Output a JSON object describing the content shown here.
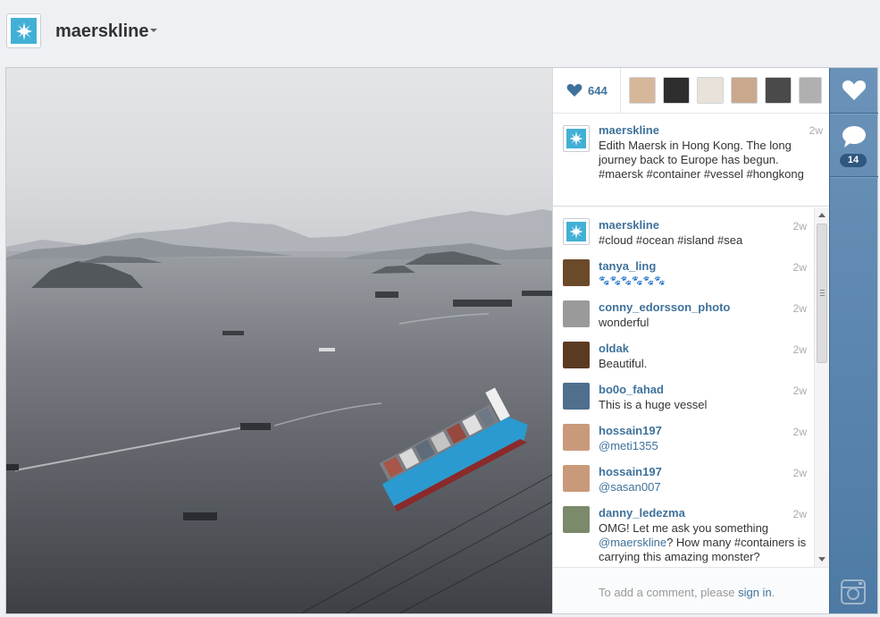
{
  "header": {
    "username": "maerskline"
  },
  "likes": {
    "count": "644"
  },
  "caption": {
    "user": "maerskline",
    "time": "2w",
    "text": "Edith Maersk in Hong Kong. The long journey back to Europe has begun. #maersk #container #vessel #hongkong"
  },
  "comments": [
    {
      "user": "maerskline",
      "time": "2w",
      "text": "#cloud #ocean #island #sea"
    },
    {
      "user": "tanya_ling",
      "time": "2w",
      "text": "🐾🐾🐾🐾🐾🐾"
    },
    {
      "user": "conny_edorsson_photo",
      "time": "2w",
      "text": "wonderful"
    },
    {
      "user": "oldak",
      "time": "2w",
      "text": "Beautiful."
    },
    {
      "user": "bo0o_fahad",
      "time": "2w",
      "text": "This is a huge vessel"
    },
    {
      "user": "hossain197",
      "time": "2w",
      "text": "@meti1355"
    },
    {
      "user": "hossain197",
      "time": "2w",
      "text": "@sasan007"
    },
    {
      "user": "danny_ledezma",
      "time": "2w",
      "text_pre": "OMG! Let me ask you something ",
      "mention": "@maerskline",
      "text_post": "? How many #containers is carrying this amazing monster?"
    }
  ],
  "add_comment": {
    "prompt": "To add a comment, please ",
    "link": "sign in",
    "suffix": "."
  },
  "actionbar": {
    "comment_count": "14"
  },
  "icons": {
    "logo": "maersk-star-icon",
    "heart": "heart-icon",
    "comment": "comment-bubble-icon",
    "camera": "instagram-camera-icon"
  },
  "colors": {
    "brand": "#42b0d5",
    "link": "#3f729b",
    "actionbar": "#5a85ad"
  }
}
